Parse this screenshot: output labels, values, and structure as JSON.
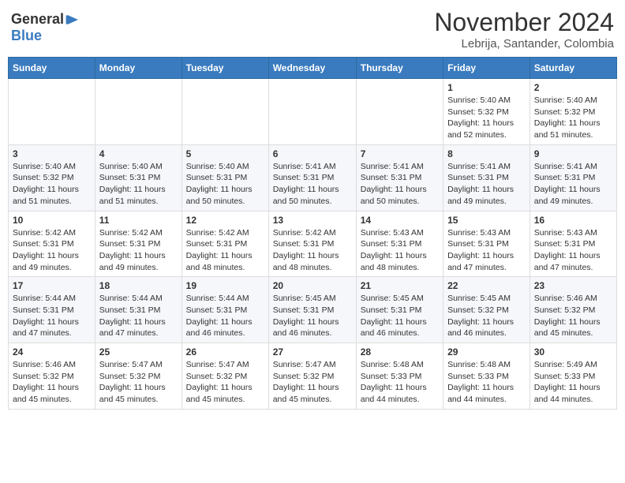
{
  "header": {
    "logo": {
      "general": "General",
      "blue": "Blue",
      "icon": "▶"
    },
    "title": "November 2024",
    "location": "Lebrija, Santander, Colombia"
  },
  "calendar": {
    "days_of_week": [
      "Sunday",
      "Monday",
      "Tuesday",
      "Wednesday",
      "Thursday",
      "Friday",
      "Saturday"
    ],
    "weeks": [
      [
        {
          "day": "",
          "info": ""
        },
        {
          "day": "",
          "info": ""
        },
        {
          "day": "",
          "info": ""
        },
        {
          "day": "",
          "info": ""
        },
        {
          "day": "",
          "info": ""
        },
        {
          "day": "1",
          "info": "Sunrise: 5:40 AM\nSunset: 5:32 PM\nDaylight: 11 hours\nand 52 minutes."
        },
        {
          "day": "2",
          "info": "Sunrise: 5:40 AM\nSunset: 5:32 PM\nDaylight: 11 hours\nand 51 minutes."
        }
      ],
      [
        {
          "day": "3",
          "info": "Sunrise: 5:40 AM\nSunset: 5:32 PM\nDaylight: 11 hours\nand 51 minutes."
        },
        {
          "day": "4",
          "info": "Sunrise: 5:40 AM\nSunset: 5:31 PM\nDaylight: 11 hours\nand 51 minutes."
        },
        {
          "day": "5",
          "info": "Sunrise: 5:40 AM\nSunset: 5:31 PM\nDaylight: 11 hours\nand 50 minutes."
        },
        {
          "day": "6",
          "info": "Sunrise: 5:41 AM\nSunset: 5:31 PM\nDaylight: 11 hours\nand 50 minutes."
        },
        {
          "day": "7",
          "info": "Sunrise: 5:41 AM\nSunset: 5:31 PM\nDaylight: 11 hours\nand 50 minutes."
        },
        {
          "day": "8",
          "info": "Sunrise: 5:41 AM\nSunset: 5:31 PM\nDaylight: 11 hours\nand 49 minutes."
        },
        {
          "day": "9",
          "info": "Sunrise: 5:41 AM\nSunset: 5:31 PM\nDaylight: 11 hours\nand 49 minutes."
        }
      ],
      [
        {
          "day": "10",
          "info": "Sunrise: 5:42 AM\nSunset: 5:31 PM\nDaylight: 11 hours\nand 49 minutes."
        },
        {
          "day": "11",
          "info": "Sunrise: 5:42 AM\nSunset: 5:31 PM\nDaylight: 11 hours\nand 49 minutes."
        },
        {
          "day": "12",
          "info": "Sunrise: 5:42 AM\nSunset: 5:31 PM\nDaylight: 11 hours\nand 48 minutes."
        },
        {
          "day": "13",
          "info": "Sunrise: 5:42 AM\nSunset: 5:31 PM\nDaylight: 11 hours\nand 48 minutes."
        },
        {
          "day": "14",
          "info": "Sunrise: 5:43 AM\nSunset: 5:31 PM\nDaylight: 11 hours\nand 48 minutes."
        },
        {
          "day": "15",
          "info": "Sunrise: 5:43 AM\nSunset: 5:31 PM\nDaylight: 11 hours\nand 47 minutes."
        },
        {
          "day": "16",
          "info": "Sunrise: 5:43 AM\nSunset: 5:31 PM\nDaylight: 11 hours\nand 47 minutes."
        }
      ],
      [
        {
          "day": "17",
          "info": "Sunrise: 5:44 AM\nSunset: 5:31 PM\nDaylight: 11 hours\nand 47 minutes."
        },
        {
          "day": "18",
          "info": "Sunrise: 5:44 AM\nSunset: 5:31 PM\nDaylight: 11 hours\nand 47 minutes."
        },
        {
          "day": "19",
          "info": "Sunrise: 5:44 AM\nSunset: 5:31 PM\nDaylight: 11 hours\nand 46 minutes."
        },
        {
          "day": "20",
          "info": "Sunrise: 5:45 AM\nSunset: 5:31 PM\nDaylight: 11 hours\nand 46 minutes."
        },
        {
          "day": "21",
          "info": "Sunrise: 5:45 AM\nSunset: 5:31 PM\nDaylight: 11 hours\nand 46 minutes."
        },
        {
          "day": "22",
          "info": "Sunrise: 5:45 AM\nSunset: 5:32 PM\nDaylight: 11 hours\nand 46 minutes."
        },
        {
          "day": "23",
          "info": "Sunrise: 5:46 AM\nSunset: 5:32 PM\nDaylight: 11 hours\nand 45 minutes."
        }
      ],
      [
        {
          "day": "24",
          "info": "Sunrise: 5:46 AM\nSunset: 5:32 PM\nDaylight: 11 hours\nand 45 minutes."
        },
        {
          "day": "25",
          "info": "Sunrise: 5:47 AM\nSunset: 5:32 PM\nDaylight: 11 hours\nand 45 minutes."
        },
        {
          "day": "26",
          "info": "Sunrise: 5:47 AM\nSunset: 5:32 PM\nDaylight: 11 hours\nand 45 minutes."
        },
        {
          "day": "27",
          "info": "Sunrise: 5:47 AM\nSunset: 5:32 PM\nDaylight: 11 hours\nand 45 minutes."
        },
        {
          "day": "28",
          "info": "Sunrise: 5:48 AM\nSunset: 5:33 PM\nDaylight: 11 hours\nand 44 minutes."
        },
        {
          "day": "29",
          "info": "Sunrise: 5:48 AM\nSunset: 5:33 PM\nDaylight: 11 hours\nand 44 minutes."
        },
        {
          "day": "30",
          "info": "Sunrise: 5:49 AM\nSunset: 5:33 PM\nDaylight: 11 hours\nand 44 minutes."
        }
      ]
    ]
  }
}
